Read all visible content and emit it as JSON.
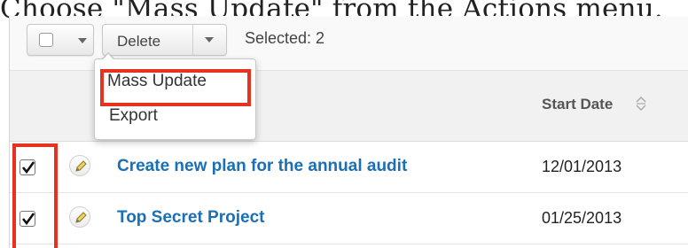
{
  "caption": "Choose \"Mass Update\" from the Actions menu.",
  "toolbar": {
    "delete_label": "Delete",
    "selected_text": "Selected: 2"
  },
  "actions_menu": {
    "items": [
      {
        "label": "Mass Update",
        "highlighted": true
      },
      {
        "label": "Export",
        "highlighted": false
      }
    ]
  },
  "table": {
    "columns": [
      {
        "label": "Start Date",
        "sortable": true
      }
    ],
    "rows": [
      {
        "checked": true,
        "name": "Create new plan for the annual audit",
        "start_date": "12/01/2013"
      },
      {
        "checked": true,
        "name": "Top Secret Project",
        "start_date": "01/25/2013"
      }
    ]
  },
  "colors": {
    "link": "#1a6fb5",
    "highlight": "#e8321f"
  },
  "icons": [
    "checkbox-icon",
    "chevron-down-icon",
    "sort-icon",
    "pencil-icon",
    "checkmark-icon"
  ]
}
